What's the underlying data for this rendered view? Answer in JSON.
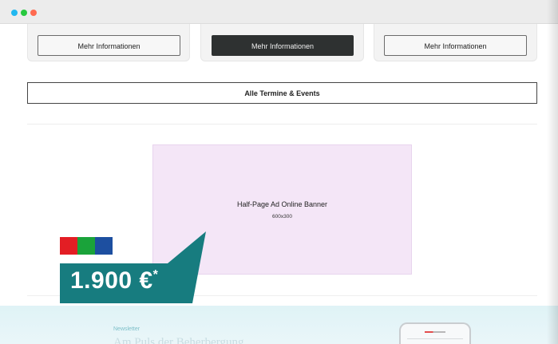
{
  "window": {
    "controls": [
      "close",
      "minimize",
      "maximize"
    ]
  },
  "cards": [
    {
      "button_label": "Mehr Informationen",
      "style": "outline"
    },
    {
      "button_label": "Mehr Informationen",
      "style": "dark"
    },
    {
      "button_label": "Mehr Informationen",
      "style": "outline"
    }
  ],
  "events": {
    "all_label": "Alle Termine & Events"
  },
  "ad": {
    "title": "Half-Page Ad Online Banner",
    "size": "600x300",
    "background": "#f4e6f7"
  },
  "price": {
    "amount": "1.900 €",
    "asterisk": "*",
    "color": "#177c7f",
    "flag_colors": [
      "#e31e24",
      "#1aa33a",
      "#1d4fa0"
    ]
  },
  "newsletter": {
    "label": "Newsletter",
    "title": "Am Puls der Beherbergung"
  }
}
